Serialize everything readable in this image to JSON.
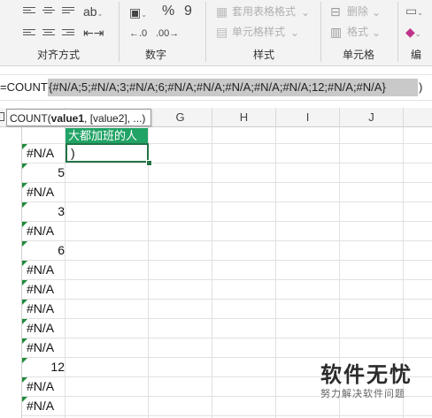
{
  "ribbon": {
    "groups": [
      {
        "label": "对齐方式"
      },
      {
        "label": "数字"
      },
      {
        "label": "样式"
      },
      {
        "label": "单元格"
      },
      {
        "label": "编"
      }
    ],
    "number": {
      "percent": "%",
      "comma": "9"
    },
    "styles": {
      "table_format": "套用表格格式",
      "cell_styles": "单元格样式"
    },
    "cells": {
      "delete": "删除",
      "format": "格式"
    }
  },
  "formula_bar": {
    "prefix": "=COUNT(",
    "array": "{#N/A;5;#N/A;3;#N/A;6;#N/A;#N/A;#N/A;#N/A;#N/A;12;#N/A;#N/A}",
    "suffix": ")"
  },
  "tooltip": {
    "func": "COUNT(",
    "arg1": "value1",
    "rest": ", [value2], ...)"
  },
  "columns": [
    "G",
    "H",
    "I",
    "J"
  ],
  "header_cell": "大都加班的人",
  "active_cell": ")",
  "cells_b": [
    "#N/A",
    "5",
    "#N/A",
    "3",
    "#N/A",
    "6",
    "#N/A",
    "#N/A",
    "#N/A",
    "#N/A",
    "#N/A",
    "12",
    "#N/A",
    "#N/A"
  ],
  "watermark": {
    "main": "软件无忧",
    "sub": "努力解决软件问题"
  }
}
